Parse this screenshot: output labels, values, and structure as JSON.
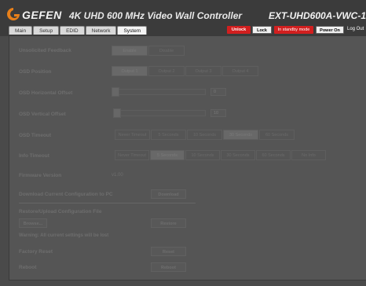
{
  "header": {
    "brand": "GEFEN",
    "title": "4K UHD 600 MHz Video Wall Controller",
    "model": "EXT-UHD600A-VWC-1"
  },
  "tabs": [
    {
      "label": "Main"
    },
    {
      "label": "Setup"
    },
    {
      "label": "EDID"
    },
    {
      "label": "Network"
    },
    {
      "label": "System"
    }
  ],
  "controls": {
    "unlock": "Unlock",
    "lock": "Lock",
    "standby": "In standby mode",
    "power_on": "Power On",
    "logout": "Log Out"
  },
  "settings": {
    "unsolicited_feedback": {
      "label": "Unsolicited Feedback",
      "options": [
        "Enable",
        "Disable"
      ],
      "selected": "Enable"
    },
    "osd_position": {
      "label": "OSD Position",
      "options": [
        "Output 1",
        "Output 2",
        "Output 3",
        "Output 4"
      ],
      "selected": "Output 1"
    },
    "osd_h_offset": {
      "label": "OSD Horizontal Offset",
      "value": "0"
    },
    "osd_v_offset": {
      "label": "OSD Vertical Offset",
      "value": "10"
    },
    "osd_timeout": {
      "label": "OSD Timeout",
      "options": [
        "Never Timeout",
        "5 Seconds",
        "10 Seconds",
        "30 Seconds",
        "60 Seconds"
      ],
      "selected": "30 Seconds"
    },
    "info_timeout": {
      "label": "Info Timeout",
      "options": [
        "Never Timeout",
        "5 Seconds",
        "10 Seconds",
        "30 Seconds",
        "60 Seconds",
        "No Info"
      ],
      "selected": "5 Seconds"
    },
    "firmware": {
      "label": "Firmware Version",
      "value": "v1.00"
    },
    "download": {
      "label": "Download Current Configuration to PC",
      "button": "Download"
    },
    "restore": {
      "label": "Restore/Upload Configuration File",
      "browse": "Browse...",
      "button": "Restore"
    },
    "warning": "Warning: All current settings will be lost",
    "factory_reset": {
      "label": "Factory Reset",
      "button": "Reset"
    },
    "reboot": {
      "label": "Reboot",
      "button": "Reboot"
    }
  },
  "colors": {
    "accent_orange": "#e8801a",
    "alert_red": "#d21f1f"
  }
}
